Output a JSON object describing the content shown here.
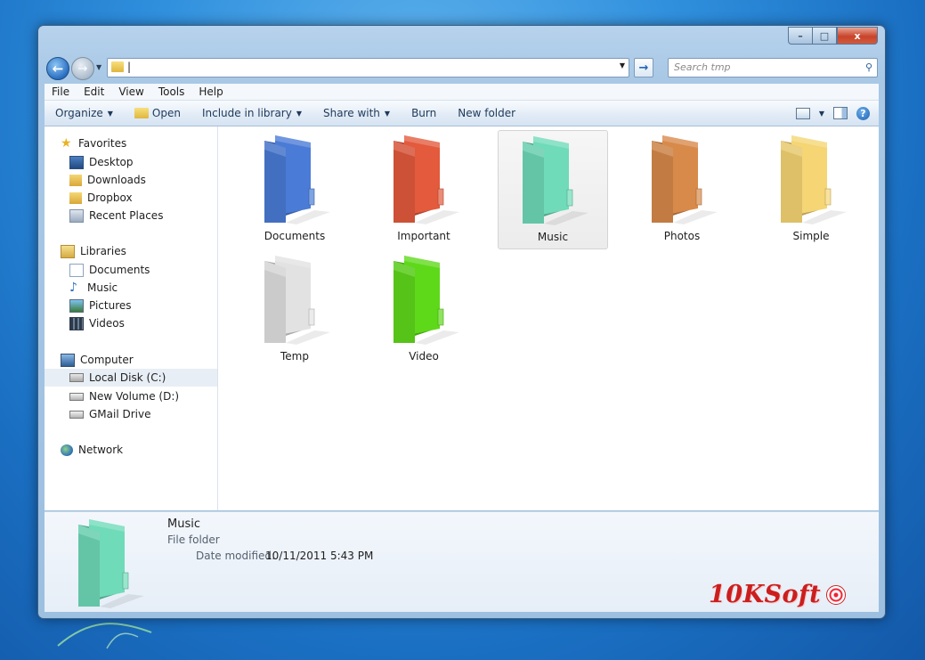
{
  "window": {
    "caption": {
      "minimize": "–",
      "maximize": "□",
      "close": "x"
    },
    "nav": {
      "back_glyph": "←",
      "forward_glyph": "→",
      "address": "|",
      "go_glyph": "→"
    },
    "search": {
      "placeholder": "Search tmp"
    }
  },
  "menubar": [
    "File",
    "Edit",
    "View",
    "Tools",
    "Help"
  ],
  "toolbar": {
    "organize": "Organize",
    "open": "Open",
    "include_in_library": "Include in library",
    "share_with": "Share with",
    "burn": "Burn",
    "new_folder": "New folder",
    "help_glyph": "?"
  },
  "sidebar": {
    "favorites": {
      "label": "Favorites",
      "items": [
        "Desktop",
        "Downloads",
        "Dropbox",
        "Recent Places"
      ]
    },
    "libraries": {
      "label": "Libraries",
      "items": [
        "Documents",
        "Music",
        "Pictures",
        "Videos"
      ]
    },
    "computer": {
      "label": "Computer",
      "items": [
        "Local Disk (C:)",
        "New Volume (D:)",
        "GMail Drive"
      ],
      "selected": "Local Disk (C:)"
    },
    "network": {
      "label": "Network"
    }
  },
  "folders": [
    {
      "name": "Documents",
      "color": "#4a7bd6",
      "selected": false
    },
    {
      "name": "Important",
      "color": "#e35a3c",
      "selected": false
    },
    {
      "name": "Music",
      "color": "#6fdbb8",
      "selected": true
    },
    {
      "name": "Photos",
      "color": "#d88a4a",
      "selected": false
    },
    {
      "name": "Simple",
      "color": "#f5d574",
      "selected": false
    },
    {
      "name": "Temp",
      "color": "#e2e2e2",
      "selected": false
    },
    {
      "name": "Video",
      "color": "#5ed91a",
      "selected": false
    }
  ],
  "details": {
    "name": "Music",
    "type": "File folder",
    "date_label": "Date modified:",
    "date_value": "10/11/2011 5:43 PM",
    "color": "#6fdbb8"
  },
  "watermark": {
    "text": "10KSoft"
  }
}
